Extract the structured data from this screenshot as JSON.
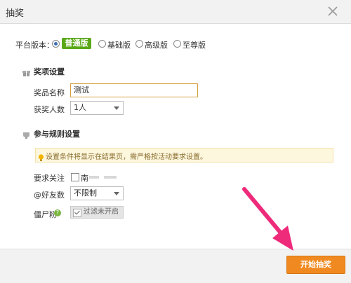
{
  "dialog": {
    "title": "抽奖"
  },
  "platform": {
    "label": "平台版本：",
    "selected": "普通版",
    "options": [
      "基础版",
      "高级版",
      "至尊版"
    ]
  },
  "prize_section": {
    "title": "奖项设置",
    "name_label": "奖品名称",
    "name_value": "测试",
    "count_label": "获奖人数",
    "count_value": "1人"
  },
  "rules_section": {
    "title": "参与规则设置",
    "tip": "设置条件将显示在结果页，需严格按活动要求设置。",
    "follow_label": "要求关注",
    "follow_option": "南",
    "friends_label": "@好友数",
    "friends_value": "不限制",
    "zombie_label": "僵尸粉",
    "zombie_filter": "过滤未开启"
  },
  "footer": {
    "start_button": "开始抽奖"
  },
  "colors": {
    "accent_orange": "#f08a20",
    "badge_green": "#5aa818",
    "arrow_pink": "#ee2a7b"
  }
}
